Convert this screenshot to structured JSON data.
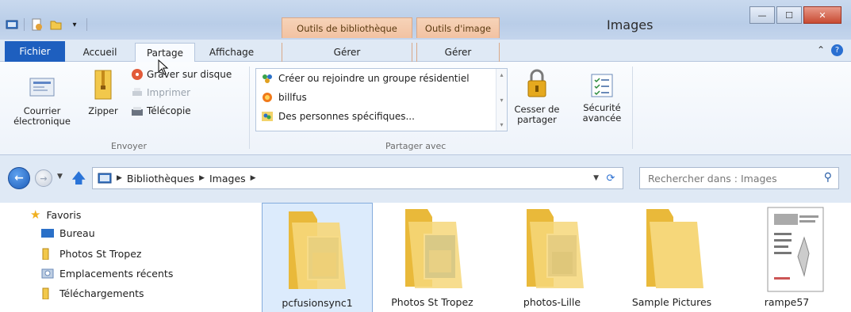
{
  "window": {
    "title": "Images",
    "minimize_glyph": "—",
    "maximize_glyph": "☐",
    "close_glyph": "✕"
  },
  "contextual_tabs": {
    "library_tools": "Outils de bibliothèque",
    "image_tools": "Outils d'image"
  },
  "tabs": {
    "file": "Fichier",
    "home": "Accueil",
    "share": "Partage",
    "view": "Affichage",
    "manage1": "Gérer",
    "manage2": "Gérer"
  },
  "ribbon": {
    "send": {
      "group_label": "Envoyer",
      "email": "Courrier électronique",
      "zip": "Zipper",
      "burn": "Graver sur disque",
      "print": "Imprimer",
      "fax": "Télécopie"
    },
    "share_with": {
      "group_label": "Partager avec",
      "items": [
        "Créer ou rejoindre un groupe résidentiel",
        "billfus",
        "Des personnes spécifiques..."
      ],
      "stop_sharing": "Cesser de partager",
      "advanced_security": "Sécurité avancée"
    }
  },
  "address_bar": {
    "crumbs": [
      "Bibliothèques",
      "Images"
    ]
  },
  "search": {
    "placeholder": "Rechercher dans : Images"
  },
  "nav_pane": {
    "items": [
      "Favoris",
      "Bureau",
      "Photos St Tropez",
      "Emplacements récents",
      "Téléchargements"
    ]
  },
  "files": [
    "pcfusionsync1",
    "Photos St Tropez",
    "photos-Lille",
    "Sample Pictures",
    "rampe57"
  ],
  "colors": {
    "file_tab": "#1e5fbf",
    "context_tab": "#f2c2a2",
    "selection": "#dcebfc",
    "close_button": "#c84a32"
  }
}
